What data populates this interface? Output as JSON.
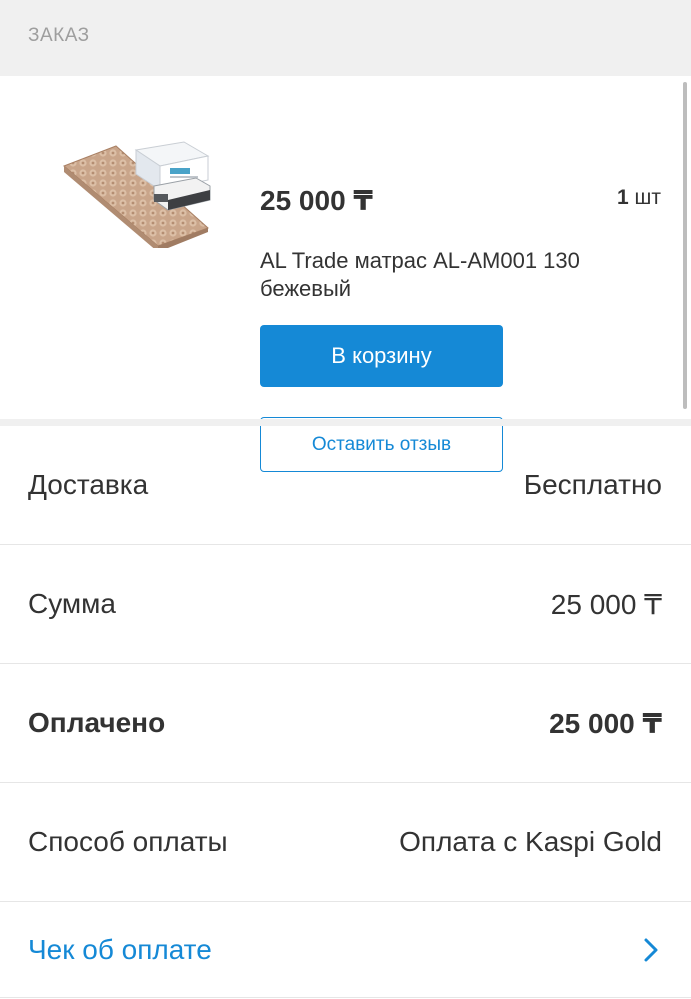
{
  "order": {
    "section_title": "ЗАКАЗ",
    "product": {
      "image_icon": "air-mattress-with-compressor",
      "price": "25 000 ₸",
      "quantity_number": "1",
      "quantity_unit": "шт",
      "title": "AL Trade матрас AL-AM001 130 бежевый"
    },
    "buttons": {
      "cart_label": "В корзину",
      "review_label": "Оставить отзыв"
    }
  },
  "summary": {
    "delivery": {
      "label": "Доставка",
      "value": "Бесплатно"
    },
    "total": {
      "label": "Сумма",
      "value": "25 000 ₸"
    },
    "paid": {
      "label": "Оплачено",
      "value": "25 000 ₸"
    },
    "payment_method": {
      "label": "Способ оплаты",
      "value": "Оплата с Kaspi Gold"
    },
    "receipt_link": {
      "label": "Чек об оплате",
      "icon": "chevron-right-icon"
    }
  },
  "colors": {
    "accent": "#1589d6",
    "text": "#333333",
    "muted": "#9e9e9e",
    "background_gray": "#f0f0f0"
  }
}
